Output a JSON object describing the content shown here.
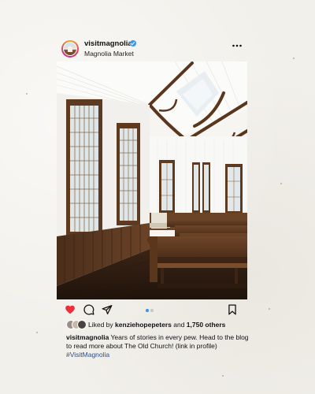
{
  "post": {
    "account": {
      "username": "visitmagnolia",
      "verified": true,
      "location": "Magnolia Market",
      "avatar_icon": "church-avatar-icon"
    },
    "menu_icon": "more-options-icon",
    "photo": {
      "subject": "church-interior-photo"
    },
    "actions": {
      "like_icon": "heart-icon",
      "like_color": "#ed2f3b",
      "comment_icon": "comment-icon",
      "share_icon": "share-icon",
      "save_icon": "bookmark-icon",
      "carousel_count": 2,
      "carousel_active_index": 0,
      "carousel_active_color": "#3897f0",
      "carousel_inactive_color": "#c7c7c7"
    },
    "likes": {
      "prefix": "Liked by",
      "user": "kenziehopepeters",
      "joiner": "and",
      "others": "1,750 others"
    },
    "caption": {
      "username": "visitmagnolia",
      "text": "Years of stories in every pew. Head to the blog to read more about The Old Church! (link in profile)",
      "hashtag": "#VisitMagnolia"
    }
  }
}
